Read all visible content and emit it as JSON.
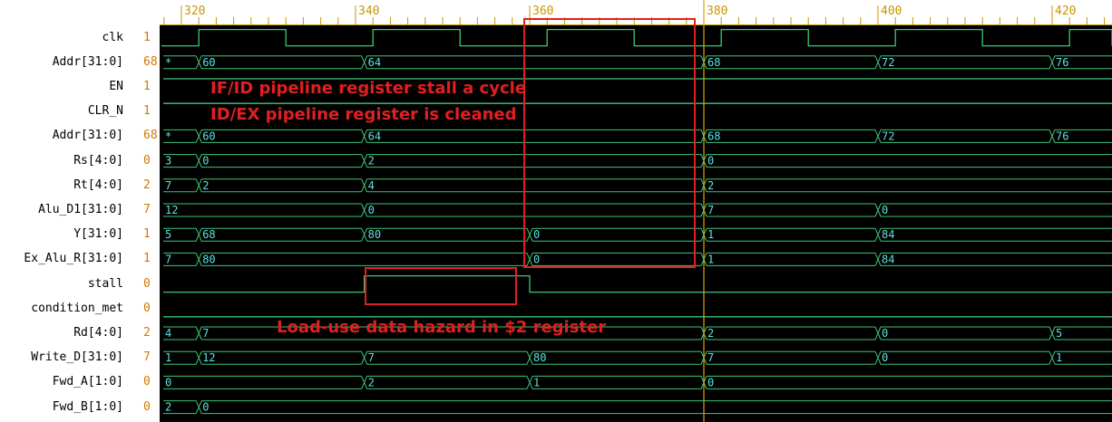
{
  "colors": {
    "wave_bg": "#000000",
    "waveform": "#3cc878",
    "clock": "#3cc878",
    "value_text": "#5fe0e0",
    "ruler_text": "#c89600",
    "cursor": "#d8a800",
    "signal_value": "#d07800",
    "annotation": "#e02020",
    "ruler_bg": "#ffffff"
  },
  "ruler": {
    "ticks": [
      {
        "label": "320",
        "time": 320
      },
      {
        "label": "340",
        "time": 340
      },
      {
        "label": "360",
        "time": 360
      },
      {
        "label": "380",
        "time": 380
      },
      {
        "label": "400",
        "time": 400
      },
      {
        "label": "420",
        "time": 420
      }
    ]
  },
  "cursor_time": 380,
  "signals": [
    {
      "name": "clk",
      "value": "1",
      "kind": "clock",
      "period": 20,
      "phase": 322,
      "start_high": true,
      "t_start": 322
    },
    {
      "name": "Addr[31:0]",
      "value": "68",
      "kind": "bus",
      "pre": "*",
      "segments": [
        {
          "t": 322,
          "v": "60"
        },
        {
          "t": 341,
          "v": "64"
        },
        {
          "t": 380,
          "v": "68"
        },
        {
          "t": 400,
          "v": "72"
        },
        {
          "t": 420,
          "v": "76"
        }
      ]
    },
    {
      "name": "EN",
      "value": "1",
      "kind": "bit",
      "level": 1,
      "edges": []
    },
    {
      "name": "CLR_N",
      "value": "1",
      "kind": "bit",
      "level": 1,
      "edges": []
    },
    {
      "name": "Addr[31:0]",
      "value": "68",
      "kind": "bus",
      "pre": "*",
      "segments": [
        {
          "t": 322,
          "v": "60"
        },
        {
          "t": 341,
          "v": "64"
        },
        {
          "t": 380,
          "v": "68"
        },
        {
          "t": 400,
          "v": "72"
        },
        {
          "t": 420,
          "v": "76"
        }
      ]
    },
    {
      "name": "Rs[4:0]",
      "value": "0",
      "kind": "bus",
      "pre": "3",
      "segments": [
        {
          "t": 322,
          "v": "0"
        },
        {
          "t": 341,
          "v": "2"
        },
        {
          "t": 380,
          "v": "0"
        }
      ]
    },
    {
      "name": "Rt[4:0]",
      "value": "2",
      "kind": "bus",
      "pre": "7",
      "segments": [
        {
          "t": 322,
          "v": "2"
        },
        {
          "t": 341,
          "v": "4"
        },
        {
          "t": 380,
          "v": "2"
        }
      ]
    },
    {
      "name": "Alu_D1[31:0]",
      "value": "7",
      "kind": "bus",
      "pre": "12",
      "segments": [
        {
          "t": 341,
          "v": "0"
        },
        {
          "t": 380,
          "v": "7"
        },
        {
          "t": 400,
          "v": "0"
        }
      ]
    },
    {
      "name": "Y[31:0]",
      "value": "1",
      "kind": "bus",
      "pre": "5",
      "segments": [
        {
          "t": 322,
          "v": "68"
        },
        {
          "t": 341,
          "v": "80"
        },
        {
          "t": 360,
          "v": "0"
        },
        {
          "t": 380,
          "v": "1"
        },
        {
          "t": 400,
          "v": "84"
        }
      ]
    },
    {
      "name": "Ex_Alu_R[31:0]",
      "value": "1",
      "kind": "bus",
      "pre": "7",
      "segments": [
        {
          "t": 322,
          "v": "80"
        },
        {
          "t": 360,
          "v": "0"
        },
        {
          "t": 380,
          "v": "1"
        },
        {
          "t": 400,
          "v": "84"
        }
      ]
    },
    {
      "name": "stall",
      "value": "0",
      "kind": "bit",
      "level": 0,
      "edges": [
        341,
        360
      ]
    },
    {
      "name": "condition_met",
      "value": "0",
      "kind": "bit",
      "level": 0,
      "edges": []
    },
    {
      "name": "Rd[4:0]",
      "value": "2",
      "kind": "bus",
      "pre": "4",
      "segments": [
        {
          "t": 322,
          "v": "7"
        },
        {
          "t": 380,
          "v": "2"
        },
        {
          "t": 400,
          "v": "0"
        },
        {
          "t": 420,
          "v": "5"
        }
      ]
    },
    {
      "name": "Write_D[31:0]",
      "value": "7",
      "kind": "bus",
      "pre": "1",
      "segments": [
        {
          "t": 322,
          "v": "12"
        },
        {
          "t": 341,
          "v": "7"
        },
        {
          "t": 360,
          "v": "80"
        },
        {
          "t": 380,
          "v": "7"
        },
        {
          "t": 400,
          "v": "0"
        },
        {
          "t": 420,
          "v": "1"
        }
      ]
    },
    {
      "name": "Fwd_A[1:0]",
      "value": "0",
      "kind": "bus",
      "pre": "0",
      "segments": [
        {
          "t": 341,
          "v": "2"
        },
        {
          "t": 360,
          "v": "1"
        },
        {
          "t": 380,
          "v": "0"
        }
      ]
    },
    {
      "name": "Fwd_B[1:0]",
      "value": "0",
      "kind": "bus",
      "pre": "2",
      "segments": [
        {
          "t": 322,
          "v": "0"
        }
      ]
    }
  ],
  "annotations": {
    "if_id_stall": "IF/ID pipeline register stall a cycle",
    "id_ex_clean": "ID/EX pipeline register is cleaned",
    "load_use": "Load-use data hazard in $2 register"
  }
}
